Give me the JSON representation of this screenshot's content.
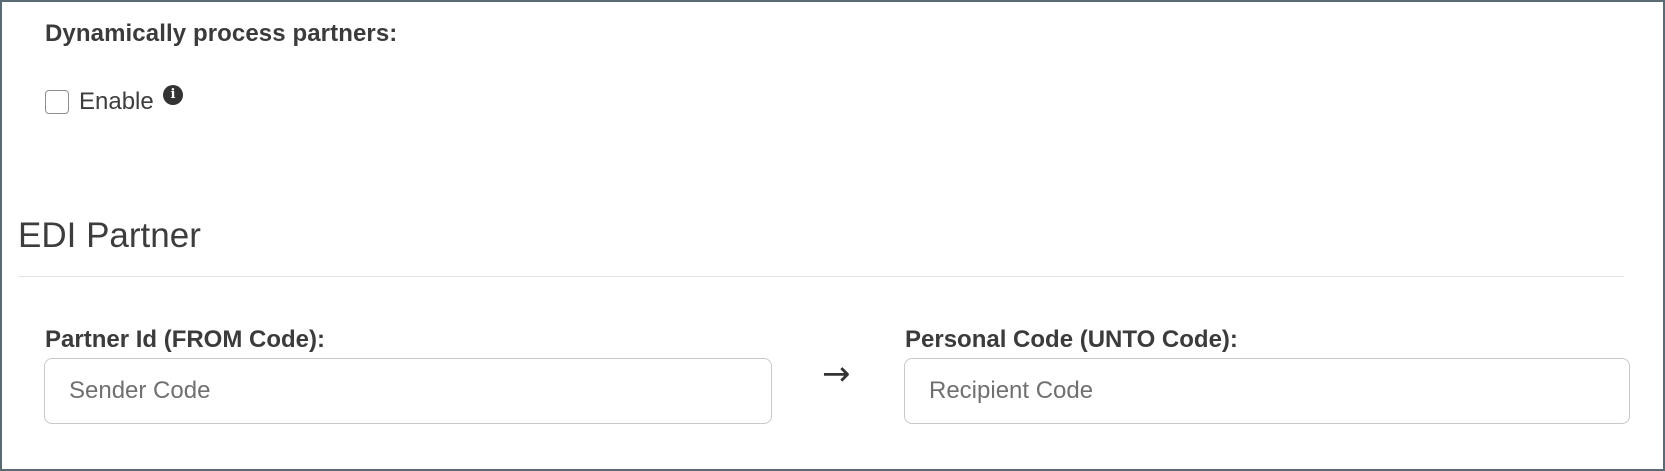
{
  "dynamic_processing": {
    "label": "Dynamically process partners:",
    "checkbox_label": "Enable",
    "checked": false,
    "info_icon": "info-circle-icon"
  },
  "section": {
    "title": "EDI Partner"
  },
  "from_field": {
    "label": "Partner Id (FROM Code):",
    "placeholder": "Sender Code",
    "value": ""
  },
  "arrow_icon": "right-arrow-icon",
  "unto_field": {
    "label": "Personal Code (UNTO Code):",
    "placeholder": "Recipient Code",
    "value": ""
  }
}
